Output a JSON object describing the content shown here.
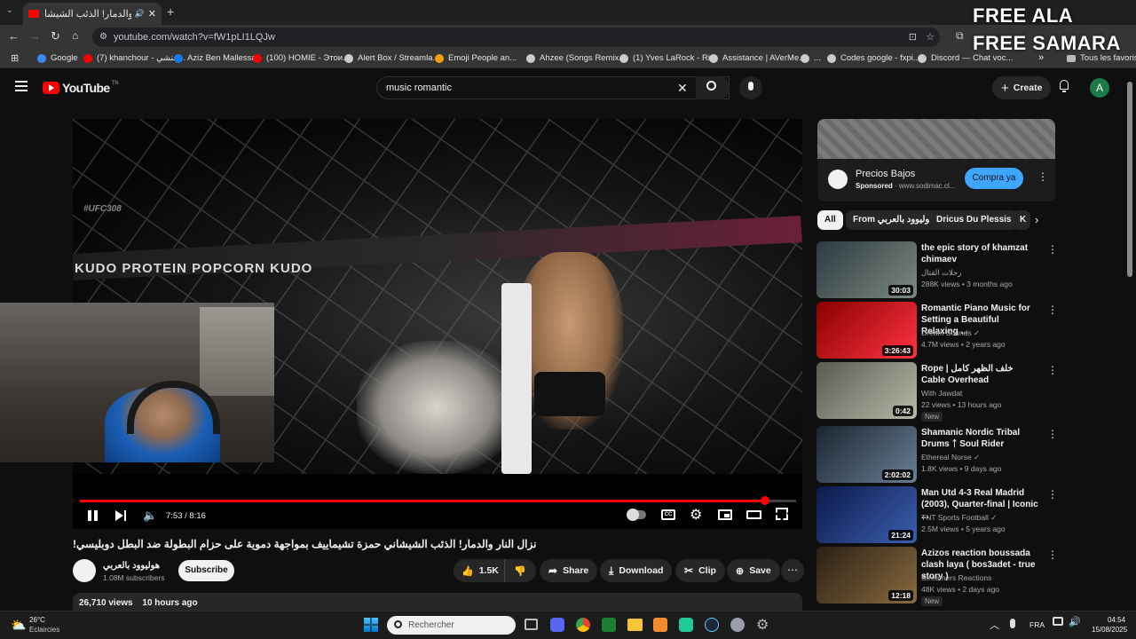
{
  "browser": {
    "tab_title": "نزال النار والدمار! الذئب الشيشا",
    "url": "youtube.com/watch?v=fW1pLI1LQJw",
    "bookmarks": [
      {
        "label": "Google",
        "color": "#4285f4"
      },
      {
        "label": "(7) khanchour - خنشي...",
        "color": "#ff0000"
      },
      {
        "label": "Aziz Ben Mallessa",
        "color": "#1877f2"
      },
      {
        "label": "(100) HOMIE - Этои...",
        "color": "#ff0000"
      },
      {
        "label": "Alert Box / Streamla...",
        "color": "#cccccc"
      },
      {
        "label": "Emoji People an...",
        "color": "#f4a00b"
      },
      {
        "label": "Ahzee (Songs Remix...",
        "color": "#cccccc"
      },
      {
        "label": "(1) Yves LaRock - Ri...",
        "color": "#cccccc"
      },
      {
        "label": "Assistance | AVerMe...",
        "color": "#cccccc"
      },
      {
        "label": "...",
        "color": "#cccccc"
      },
      {
        "label": "Codes google - fxpi...",
        "color": "#cccccc"
      },
      {
        "label": "Discord — Chat voc...",
        "color": "#cccccc"
      }
    ],
    "all_bookmarks": "Tous les favoris"
  },
  "overlay": {
    "line1": "FREE ALA",
    "line2": "FREE SAMARA"
  },
  "youtube": {
    "logo": "YouTube",
    "logo_sup": "TN",
    "search_value": "music romantic",
    "create_label": "Create",
    "avatar_letter": "A"
  },
  "player": {
    "time": "7:53 / 8:16",
    "progress": 0.957,
    "watermark": "#UFC308",
    "banner_text": "KUDO PROTEIN POPCORN KUDO"
  },
  "video": {
    "title": "نزال النار والدمار! الذئب الشيشاني حمزة تشيماييف بمواجهة دموية على حزام البطولة ضد البطل دوبليسي!",
    "channel": "هوليوود بالعربي",
    "subscribers": "1.08M subscribers",
    "subscribe_label": "Subscribe",
    "likes": "1.5K",
    "share_label": "Share",
    "download_label": "Download",
    "clip_label": "Clip",
    "save_label": "Save",
    "views": "26,710 views",
    "age": "10 hours ago"
  },
  "ad": {
    "title": "Precios Bajos",
    "sponsored": "Sponsored",
    "domain": "· www.sodimac.cl...",
    "cta": "Compra ya"
  },
  "chips": [
    "All",
    "From هوليوود بالعربي",
    "Dricus Du Plessis",
    "K"
  ],
  "recommendations": [
    {
      "title": "the epic story of khamzat chimaev",
      "channel": "رحلات القتال",
      "meta": "288K views • 3 months ago",
      "duration": "30:03",
      "badge": "",
      "colors": [
        "#2d3a40",
        "#7d8a80"
      ]
    },
    {
      "title": "Romantic Piano Music for Setting a Beautiful Relaxing ...",
      "channel": "Dream Sounds ✓",
      "meta": "4.7M views • 2 years ago",
      "duration": "3:26:43",
      "badge": "",
      "colors": [
        "#8a0000",
        "#ff3344"
      ]
    },
    {
      "title": "Rope | خلف الظهر كامل Cable Overhead",
      "channel": "With Jawdat",
      "meta": "22 views • 13 hours ago",
      "duration": "0:42",
      "badge": "New",
      "colors": [
        "#5a5a52",
        "#b8b8a8"
      ]
    },
    {
      "title": "Shamanic Nordic Tribal Drums ᛏ Soul Rider",
      "channel": "Ethereal Norse ✓",
      "meta": "1.8K views • 9 days ago",
      "duration": "2:02:02",
      "badge": "",
      "colors": [
        "#1a2530",
        "#6a7f95"
      ]
    },
    {
      "title": "Man Utd 4-3 Real Madrid (2003), Quarter-final | Iconic ...",
      "channel": "TNT Sports Football ✓",
      "meta": "2.5M views • 5 years ago",
      "duration": "21:24",
      "badge": "",
      "colors": [
        "#0b1a4a",
        "#3c5fb0"
      ]
    },
    {
      "title": "Azizos reaction boussada clash laya ( bos3adet - true story )",
      "channel": "Streamers Reactions",
      "meta": "48K views • 2 days ago",
      "duration": "12:18",
      "badge": "New",
      "colors": [
        "#2a2015",
        "#8a6a40"
      ]
    }
  ],
  "taskbar": {
    "temp": "26°C",
    "weather": "Eclaircies",
    "search_placeholder": "Rechercher",
    "lang": "FRA",
    "time": "04:54",
    "date": "15/08/2025"
  }
}
